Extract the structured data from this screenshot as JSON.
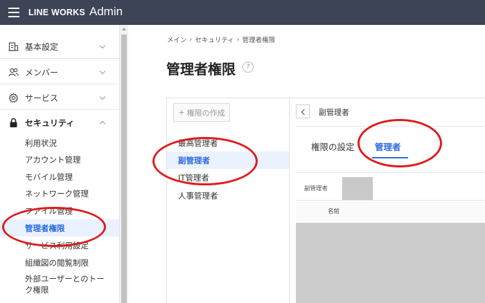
{
  "header": {
    "logo": "LINE WORKS",
    "title": "Admin"
  },
  "sidebar": {
    "groups": [
      {
        "label": "基本設定",
        "icon": "building-icon"
      },
      {
        "label": "メンバー",
        "icon": "members-icon"
      },
      {
        "label": "サービス",
        "icon": "gear-icon"
      },
      {
        "label": "セキュリティ",
        "icon": "lock-icon"
      }
    ],
    "security_items": [
      {
        "label": "利用状況"
      },
      {
        "label": "アカウント管理"
      },
      {
        "label": "モバイル管理"
      },
      {
        "label": "ネットワーク管理"
      },
      {
        "label": "ファイル管理"
      },
      {
        "label": "管理者権限"
      },
      {
        "label": "サービス利用設定"
      },
      {
        "label": "組織図の閲覧制限"
      },
      {
        "label": "外部ユーザーとのトーク権限"
      }
    ]
  },
  "breadcrumb": [
    "メイン",
    "セキュリティ",
    "管理者権限"
  ],
  "breadcrumb_sep": "›",
  "page": {
    "title": "管理者権限",
    "help": "?"
  },
  "roles_pane": {
    "create_label": "権限の作成",
    "create_icon": "+",
    "roles": [
      {
        "label": "最高管理者"
      },
      {
        "label": "副管理者"
      },
      {
        "label": "IT管理者"
      },
      {
        "label": "人事管理者"
      }
    ]
  },
  "detail": {
    "title": "副管理者",
    "tabs": [
      {
        "label": "権限の設定"
      },
      {
        "label": "管理者"
      }
    ],
    "field_label": "副管理者",
    "column_name": "名前"
  },
  "colors": {
    "topbar": "#3d4455",
    "accent": "#2c6be0",
    "annotation": "#e01b1b",
    "selected_bg": "#eaf1ff"
  }
}
